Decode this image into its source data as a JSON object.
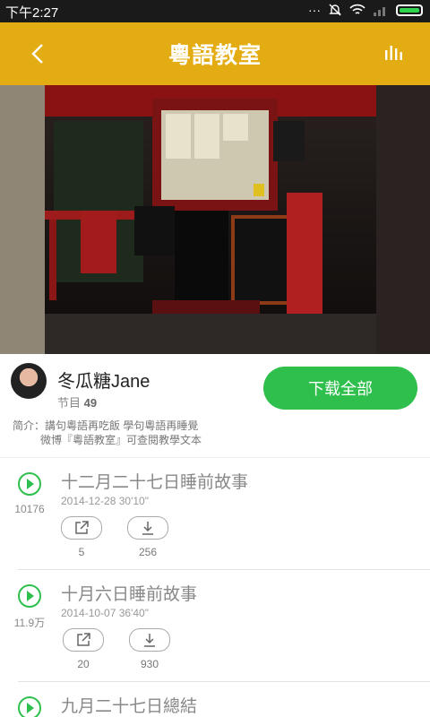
{
  "status": {
    "time": "下午2:27"
  },
  "appbar": {
    "title": "粵語教室"
  },
  "author": {
    "name": "冬瓜糖Jane",
    "program_label": "节目",
    "program_count": "49",
    "download_all": "下载全部",
    "intro_line1": "简介：講句粵語再吃飯   學句粵語再睡覺",
    "intro_line2": "微博『粵語教室』可查閱教學文本"
  },
  "episodes": [
    {
      "title": "十二月二十七日睡前故事",
      "meta": "2014-12-28  30'10\"",
      "plays": "10176",
      "shares": "5",
      "downloads": "256"
    },
    {
      "title": "十月六日睡前故事",
      "meta": "2014-10-07  36'40\"",
      "plays": "11.9万",
      "shares": "20",
      "downloads": "930"
    },
    {
      "title": "九月二十七日總結",
      "meta": "",
      "plays": "",
      "shares": "",
      "downloads": ""
    }
  ],
  "icons": {
    "back": "chevron-left-icon",
    "equalizer": "equalizer-icon",
    "share": "share-icon",
    "download": "download-icon",
    "play": "play-icon"
  },
  "colors": {
    "appbar": "#e3ac12",
    "accent": "#2fbf4d"
  }
}
